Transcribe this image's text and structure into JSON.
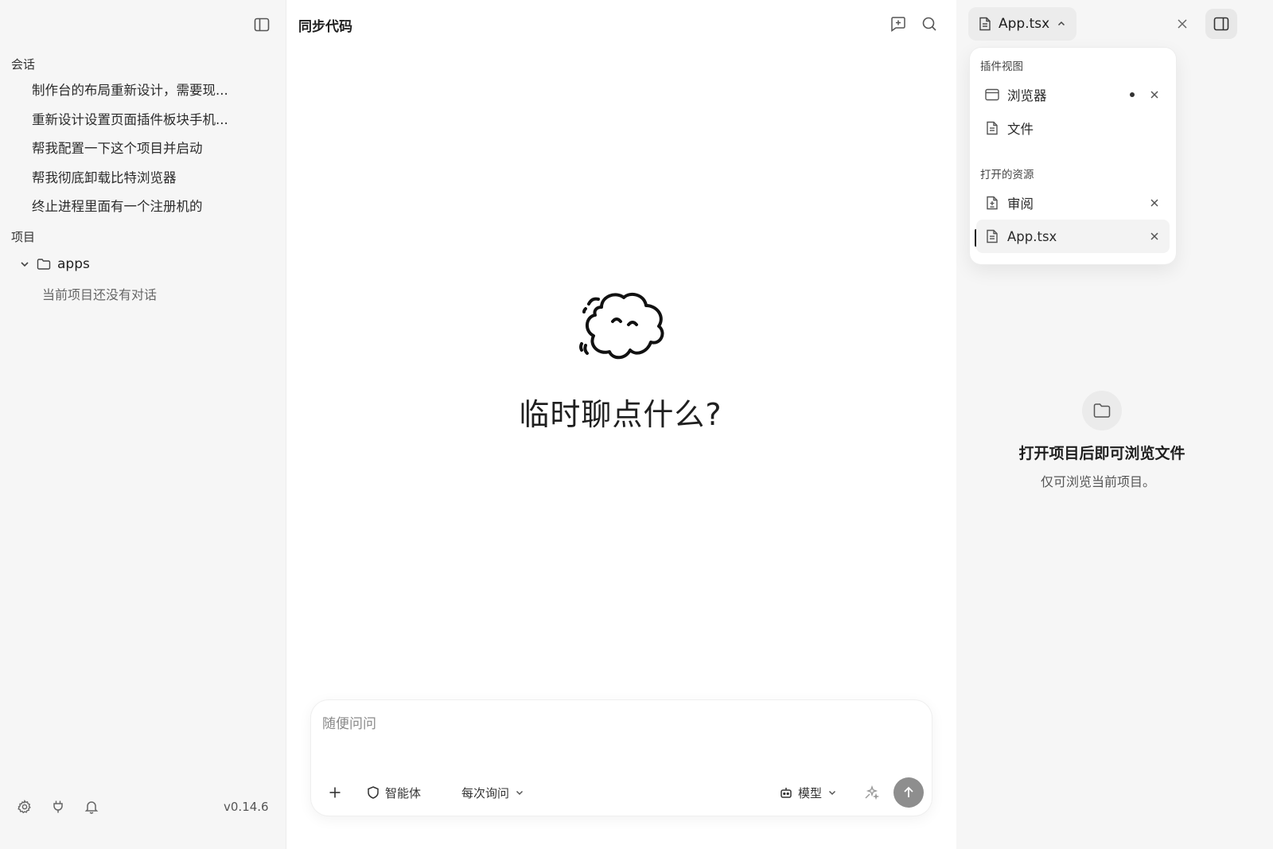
{
  "sidebar": {
    "sessions_title": "会话",
    "sessions": [
      "制作台的布局重新设计，需要现...",
      "重新设计设置页面插件板块手机...",
      "帮我配置一下这个项目并启动",
      "帮我彻底卸载比特浏览器",
      "终止进程里面有一个注册机的"
    ],
    "projects_title": "项目",
    "project_name": "apps",
    "project_empty": "当前项目还没有对话",
    "version": "v0.14.6"
  },
  "main": {
    "title": "同步代码",
    "hero": "临时聊点什么?",
    "composer": {
      "placeholder": "随便问问",
      "agent_label": "智能体",
      "ask_label": "每次询问",
      "model_label": "模型"
    }
  },
  "right_panel": {
    "tab_label": "App.tsx",
    "empty_title": "打开项目后即可浏览文件",
    "empty_sub": "仅可浏览当前项目。",
    "dropdown": {
      "plugin_views_title": "插件视图",
      "plugin_views": [
        "浏览器",
        "文件"
      ],
      "open_resources_title": "打开的资源",
      "open_resources": [
        "审阅",
        "App.tsx"
      ]
    }
  }
}
